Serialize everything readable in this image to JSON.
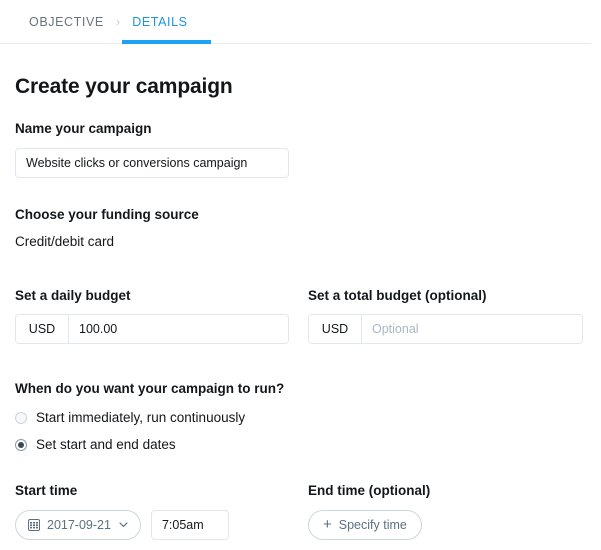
{
  "steps": {
    "items": [
      {
        "label": "OBJECTIVE",
        "active": false
      },
      {
        "label": "DETAILS",
        "active": true
      }
    ],
    "separator": "›"
  },
  "page": {
    "title": "Create your campaign"
  },
  "campaign_name": {
    "label": "Name your campaign",
    "value": "Website clicks or conversions campaign",
    "placeholder": ""
  },
  "funding_source": {
    "label": "Choose your funding source",
    "value": "Credit/debit card"
  },
  "daily_budget": {
    "label": "Set a daily budget",
    "currency": "USD",
    "value": "100.00",
    "placeholder": ""
  },
  "total_budget": {
    "label": "Set a total budget (optional)",
    "currency": "USD",
    "value": "",
    "placeholder": "Optional"
  },
  "schedule": {
    "label": "When do you want your campaign to run?",
    "options": [
      {
        "label": "Start immediately, run continuously",
        "checked": false
      },
      {
        "label": "Set start and end dates",
        "checked": true
      }
    ]
  },
  "start_time": {
    "label": "Start time",
    "date": "2017-09-21",
    "time": "7:05am",
    "calendar_icon": "calendar-icon",
    "chevron_icon": "chevron-down-icon"
  },
  "end_time": {
    "label": "End time (optional)",
    "button_label": "Specify time",
    "plus_icon": "plus-icon"
  },
  "colors": {
    "accent": "#1da1f2",
    "active_tab_text": "#1b95e0",
    "inactive_tab_text": "#66757f",
    "text": "#14171a",
    "border": "#e1e8ed",
    "pill_border": "#ccd6dd",
    "pill_text": "#5b7083",
    "placeholder": "#aab8c2"
  }
}
